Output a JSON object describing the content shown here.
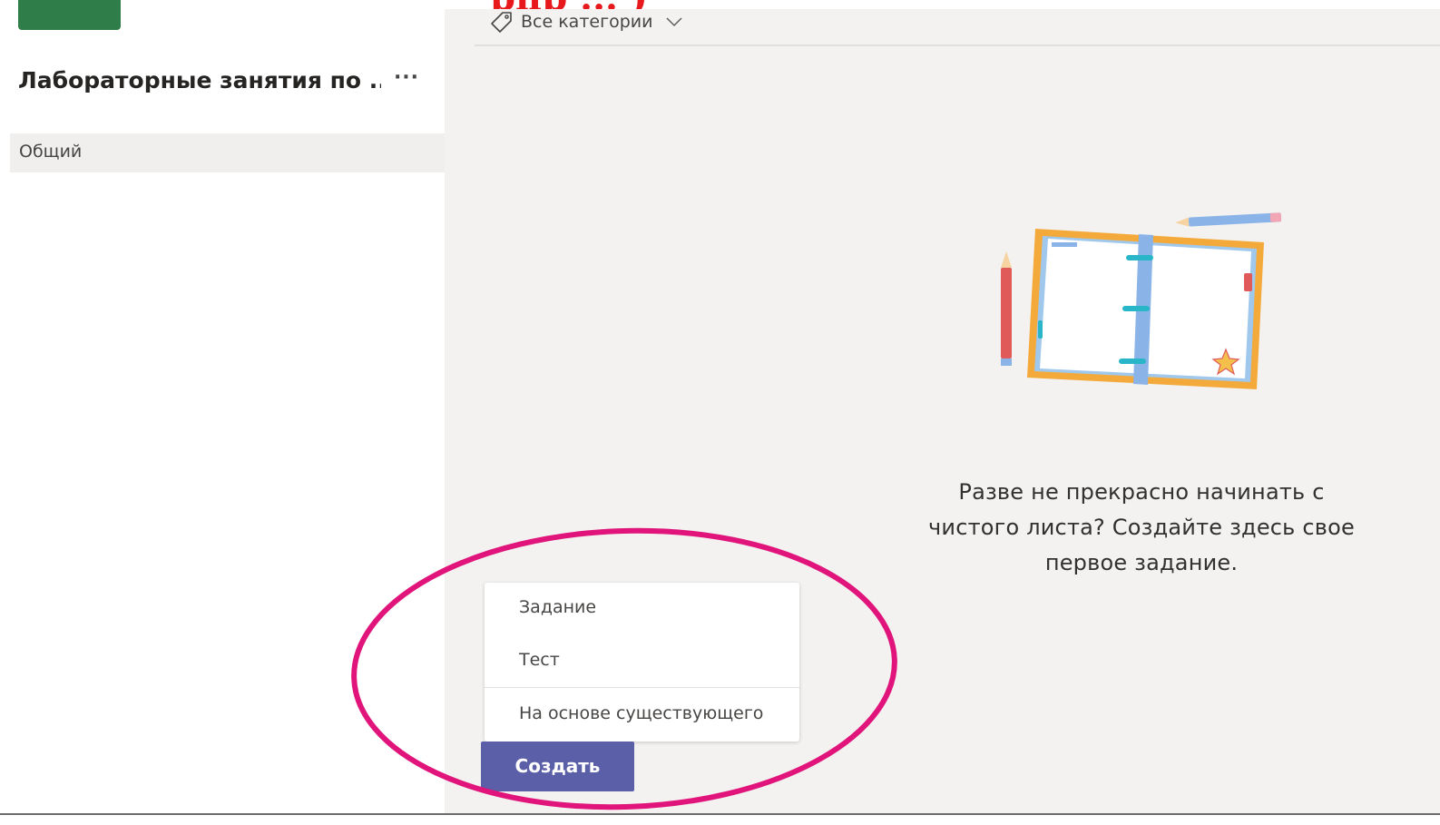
{
  "header": {
    "overlay_title_fragment": "рпр ... )"
  },
  "sidebar": {
    "team_name": "Лабораторные занятия по ...",
    "more_label": "···",
    "channels": [
      {
        "label": "Общий",
        "selected": true
      }
    ]
  },
  "filter": {
    "label": "Все категории",
    "icon": "tag-icon"
  },
  "empty_state": {
    "message": "Разве не прекрасно начинать с чистого листа? Создайте здесь свое первое задание."
  },
  "create_menu": {
    "items": [
      {
        "label": "Задание"
      },
      {
        "label": "Тест"
      },
      {
        "label": "На основе существующего"
      }
    ]
  },
  "create_button": {
    "label": "Создать"
  },
  "colors": {
    "team_badge": "#2f7d48",
    "accent": "#5b5fa8",
    "annotation": "#e0147a",
    "main_bg": "#f3f2f1"
  }
}
